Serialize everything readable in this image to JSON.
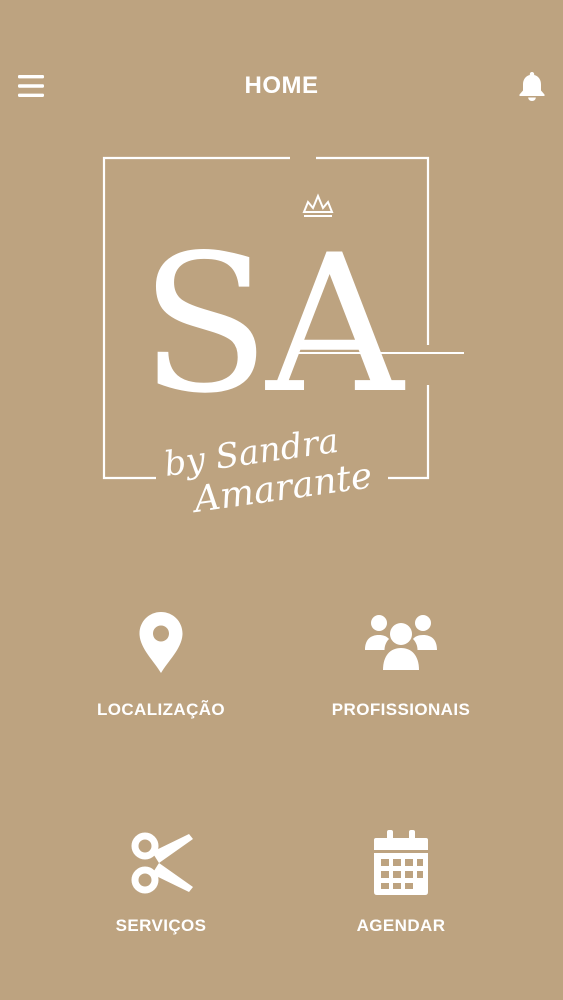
{
  "header": {
    "title": "HOME",
    "menu_icon": "hamburger-menu-icon",
    "notification_icon": "bell-icon"
  },
  "logo": {
    "monogram": "SA",
    "tagline_line1": "by Sandra",
    "tagline_line2": "Amarante"
  },
  "menu": {
    "items": [
      {
        "label": "LOCALIZAÇÃO",
        "icon": "location-pin-icon"
      },
      {
        "label": "PROFISSIONAIS",
        "icon": "users-group-icon"
      },
      {
        "label": "SERVIÇOS",
        "icon": "scissors-icon"
      },
      {
        "label": "AGENDAR",
        "icon": "calendar-icon"
      }
    ]
  },
  "colors": {
    "background": "#BDA380",
    "foreground": "#FFFFFF"
  }
}
